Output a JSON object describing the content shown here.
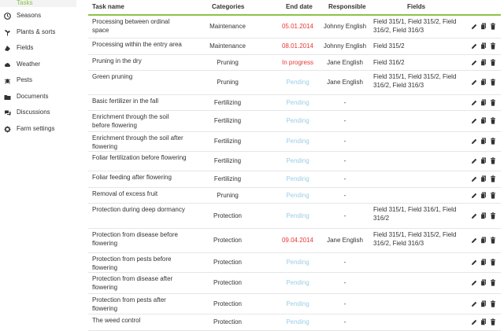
{
  "sidebar": {
    "active_label": "Tasks",
    "items": [
      {
        "label": "Seasons",
        "icon": "seasons-icon"
      },
      {
        "label": "Plants & sorts",
        "icon": "plants-icon"
      },
      {
        "label": "Fields",
        "icon": "fields-icon"
      },
      {
        "label": "Weather",
        "icon": "weather-icon"
      },
      {
        "label": "Pests",
        "icon": "pests-icon"
      },
      {
        "label": "Documents",
        "icon": "documents-icon"
      },
      {
        "label": "Discussions",
        "icon": "discussions-icon"
      },
      {
        "label": "Farm settings",
        "icon": "gear-icon"
      }
    ]
  },
  "table": {
    "headers": {
      "task": "Task name",
      "categories": "Categories",
      "end_date": "End date",
      "responsible": "Responsible",
      "fields": "Fields"
    },
    "rows": [
      {
        "task": "Processing between ordinal space",
        "category": "Maintenance",
        "end_date": "05.01.2014",
        "status": "overdue",
        "responsible": "Johnny English",
        "fields": "Field 315/1, Field 315/2, Field 316/2, Field 316/3"
      },
      {
        "task": "Processing within the entry area",
        "category": "Maintenance",
        "end_date": "08.01.2014",
        "status": "overdue",
        "responsible": "Johnny English",
        "fields": "Field 315/2"
      },
      {
        "task": "Pruning in the dry",
        "category": "Pruning",
        "end_date": "In progress",
        "status": "progress",
        "responsible": "Jane English",
        "fields": "Field 316/2"
      },
      {
        "task": "Green pruning",
        "category": "Pruning",
        "end_date": "Pending",
        "status": "pending",
        "responsible": "Jane English",
        "fields": "Field 315/1, Field 315/2, Field 316/2, Field 316/3"
      },
      {
        "task": "Basic fertilizer in the fall",
        "category": "Fertilizing",
        "end_date": "Pending",
        "status": "pending",
        "responsible": "-",
        "fields": ""
      },
      {
        "task": "Enrichment through the soil before flowering",
        "category": "Fertilizing",
        "end_date": "Pending",
        "status": "pending",
        "responsible": "-",
        "fields": ""
      },
      {
        "task": "Enrichment through the soil after flowering",
        "category": "Fertilizing",
        "end_date": "Pending",
        "status": "pending",
        "responsible": "-",
        "fields": ""
      },
      {
        "task": "Foliar fertilization before flowering",
        "category": "Fertilizing",
        "end_date": "Pending",
        "status": "pending",
        "responsible": "-",
        "fields": ""
      },
      {
        "task": "Foliar feeding after flowering",
        "category": "Fertilizing",
        "end_date": "Pending",
        "status": "pending",
        "responsible": "-",
        "fields": ""
      },
      {
        "task": "Removal of excess fruit",
        "category": "Pruning",
        "end_date": "Pending",
        "status": "pending",
        "responsible": "-",
        "fields": ""
      },
      {
        "task": "Protection during deep dormancy",
        "category": "Protection",
        "end_date": "Pending",
        "status": "pending",
        "responsible": "-",
        "fields": "Field 315/1, Field 316/1, Field 316/2"
      },
      {
        "task": "Protection from disease before flowering",
        "category": "Protection",
        "end_date": "09.04.2014",
        "status": "overdue",
        "responsible": "Jane English",
        "fields": "Field 315/1, Field 315/2, Field 316/2, Field 316/3"
      },
      {
        "task": "Protection from pests before flowering",
        "category": "Protection",
        "end_date": "Pending",
        "status": "pending",
        "responsible": "-",
        "fields": ""
      },
      {
        "task": "Protection from disease after flowering",
        "category": "Protection",
        "end_date": "Pending",
        "status": "pending",
        "responsible": "-",
        "fields": ""
      },
      {
        "task": "Protection from pests after flowering",
        "category": "Protection",
        "end_date": "Pending",
        "status": "pending",
        "responsible": "-",
        "fields": ""
      },
      {
        "task": "The weed control",
        "category": "Protection",
        "end_date": "Pending",
        "status": "pending",
        "responsible": "-",
        "fields": ""
      }
    ]
  },
  "colors": {
    "accent": "#8bc34a",
    "overdue": "#e53935",
    "pending": "#9ccde6"
  },
  "row_actions": [
    "pencil-icon",
    "copy-icon",
    "trash-icon"
  ]
}
